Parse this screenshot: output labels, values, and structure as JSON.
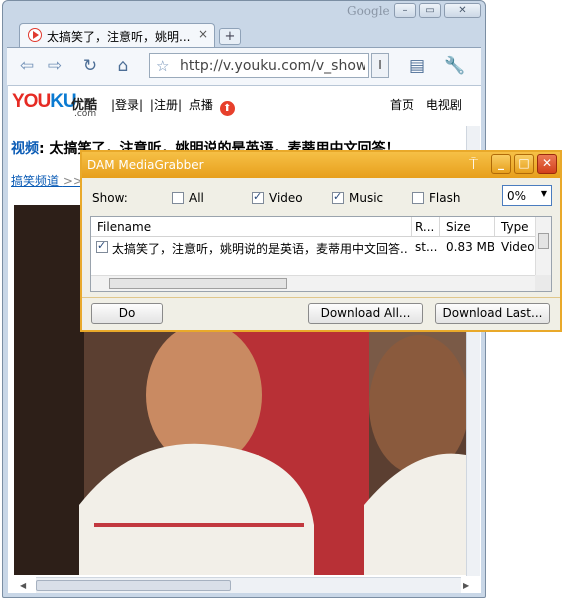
{
  "browser": {
    "brand": "Google",
    "tab_title": "太搞笑了，注意听，姚明...",
    "tab_close": "×",
    "new_tab": "+",
    "url": "http://v.youku.com/v_show/i",
    "go_label": "I",
    "icons": [
      "back-icon",
      "forward-icon",
      "reload-icon",
      "home-icon",
      "star-icon",
      "page-menu-icon",
      "wrench-icon"
    ]
  },
  "page": {
    "logo_text_red": "YOU",
    "logo_text_blue": "KU",
    "logo_cn": "优酷",
    "logo_com": ".com",
    "nav_login": "|登录|",
    "nav_register": "|注册|",
    "nav_upload": "点播",
    "nav_home": "首页",
    "nav_tv": "电视剧",
    "headline_label": "视频",
    "headline_text": ": 太搞笑了，注意听，姚明说的是英语，麦蒂用中文回答！",
    "crumb": "搞笑频道",
    "crumb_arrow": ">>"
  },
  "dialog": {
    "title": "DAM MediaGrabber",
    "show_label": "Show:",
    "filters": [
      {
        "label": "All",
        "checked": false
      },
      {
        "label": "Video",
        "checked": true
      },
      {
        "label": "Music",
        "checked": true
      },
      {
        "label": "Flash",
        "checked": false
      }
    ],
    "percent_value": "0%",
    "columns": [
      "Filename",
      "R...",
      "Size",
      "Type"
    ],
    "rows": [
      {
        "checked": true,
        "filename": "太搞笑了，注意听，姚明说的是英语，麦蒂用中文回答...",
        "r": "st...",
        "size": "0.83 MB",
        "type": "Video"
      }
    ],
    "buttons": {
      "do": "Do",
      "download_all": "Download All...",
      "download_last": "Download Last..."
    },
    "accent_color": "#e9a92a"
  }
}
